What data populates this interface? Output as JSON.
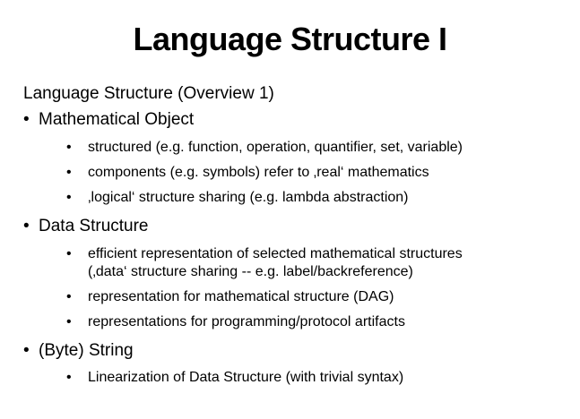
{
  "slide": {
    "title": "Language Structure I",
    "intro": "Language Structure (Overview 1)",
    "bullet_char": "•",
    "sections": [
      {
        "label": "Mathematical Object",
        "items": [
          "structured (e.g. function, operation, quantifier, set, variable)",
          "components (e.g. symbols) refer to ‚real‘ mathematics",
          "‚logical‘ structure sharing (e.g. lambda abstraction)"
        ]
      },
      {
        "label": "Data Structure",
        "items": [
          "efficient representation of selected mathematical structures",
          "(‚data‘ structure sharing -- e.g. label/backreference)",
          "representation for mathematical structure (DAG)",
          "representations for programming/protocol artifacts"
        ]
      },
      {
        "label": "(Byte) String",
        "items": [
          "Linearization of Data Structure (with trivial syntax)"
        ]
      }
    ]
  }
}
